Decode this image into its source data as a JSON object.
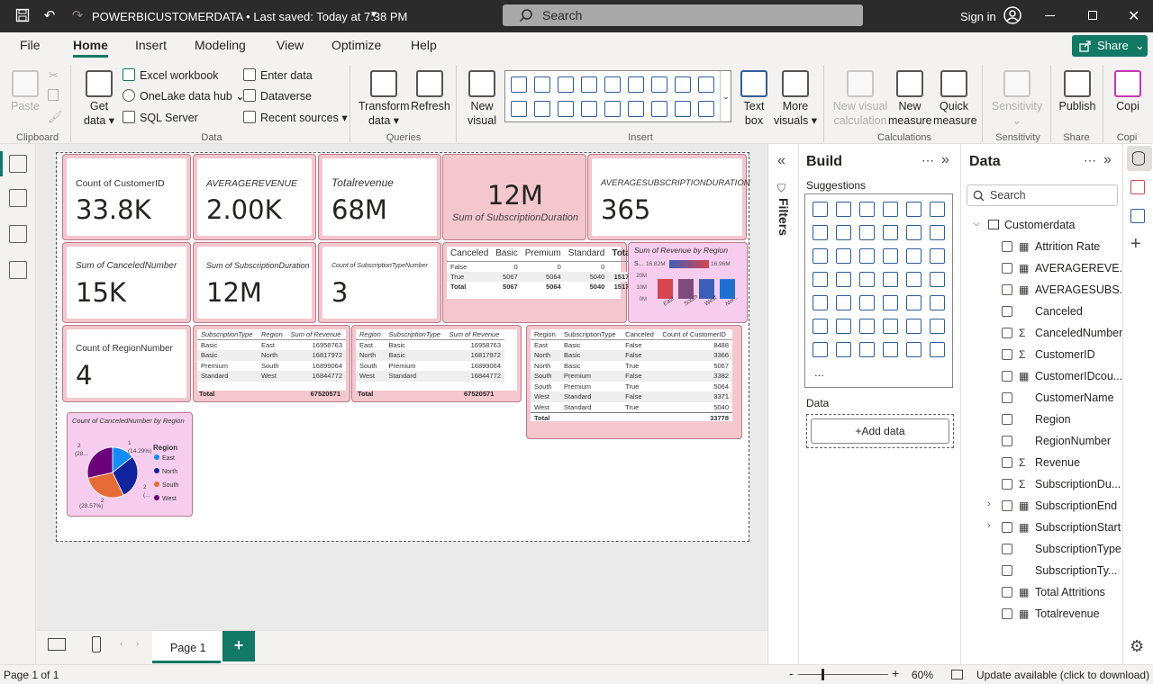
{
  "titlebar": {
    "title": "POWERBICUSTOMERDATA • Last saved: Today at 7:38 PM",
    "search": "Search",
    "signin": "Sign in"
  },
  "ribbon": {
    "tabs": [
      "File",
      "Home",
      "Insert",
      "Modeling",
      "View",
      "Optimize",
      "Help"
    ],
    "share": "Share",
    "paste": "Paste",
    "getdata": [
      "Get",
      "data ▾"
    ],
    "excel": "Excel workbook",
    "onelake": "OneLake data hub ⌄",
    "sql": "SQL Server",
    "enterdata": "Enter data",
    "dataverse": "Dataverse",
    "recent": "Recent sources ▾",
    "transform": [
      "Transform",
      "data ▾"
    ],
    "refresh": "Refresh",
    "newvisual": [
      "New",
      "visual"
    ],
    "textbox": [
      "Text",
      "box"
    ],
    "morevisuals": [
      "More",
      "visuals ▾"
    ],
    "newvisualcalc": [
      "New visual",
      "calculation"
    ],
    "newmeasure": [
      "New",
      "measure"
    ],
    "quickmeasure": [
      "Quick",
      "measure"
    ],
    "sensitivity": [
      "Sensitivity",
      "⌄"
    ],
    "publish": "Publish",
    "copilot": "Copi",
    "groups": [
      "Clipboard",
      "Data",
      "Queries",
      "Insert",
      "Calculations",
      "Sensitivity",
      "Share",
      "Copi"
    ]
  },
  "report": {
    "cards": [
      {
        "label": "Count of CustomerID",
        "value": "33.8K",
        "italic": false
      },
      {
        "label": "AVERAGEREVENUE",
        "value": "2.00K",
        "italic": true
      },
      {
        "label": "Totalrevenue",
        "value": "68M",
        "italic": true
      },
      {
        "label": "Sum of SubscriptionDuration",
        "value": "12M",
        "italic": true
      },
      {
        "label": "AVERAGESUBSCRIPTIONDURATION",
        "value": "365",
        "italic": true
      },
      {
        "label": "Sum of CanceledNumber",
        "value": "15K",
        "italic": true
      },
      {
        "label": "Sum of SubscriptionDuration",
        "value": "12M",
        "italic": true
      },
      {
        "label": "Count of SubscriptionTypeNumber",
        "value": "3",
        "italic": true
      },
      {
        "label": "Count of RegionNumber",
        "value": "4",
        "italic": false
      }
    ],
    "matrix": {
      "headers": [
        "Canceled",
        "Basic",
        "Premium",
        "Standard",
        "Total"
      ],
      "rows": [
        [
          "False",
          "0",
          "0",
          "0",
          "0"
        ],
        [
          "True",
          "5067",
          "5064",
          "5040",
          "15171"
        ],
        [
          "Total",
          "5067",
          "5064",
          "5040",
          "15171"
        ]
      ]
    },
    "revenue_by_region": {
      "title": "Sum of Revenue by Region",
      "legend_prefix": "S...",
      "legend_min": "16.82M",
      "legend_max": "16.96M",
      "yticks": [
        "20M",
        "10M",
        "0M"
      ]
    },
    "table1": {
      "headers": [
        "SubscriptionType",
        "Region",
        "Sum of Revenue"
      ],
      "rows": [
        [
          "Basic",
          "East",
          "16958763"
        ],
        [
          "Basic",
          "North",
          "16817972"
        ],
        [
          "Premium",
          "South",
          "16899064"
        ],
        [
          "Standard",
          "West",
          "16844772"
        ]
      ],
      "total": [
        "Total",
        "",
        "67520571"
      ]
    },
    "table2": {
      "headers": [
        "Region",
        "SubscriptionType",
        "Sum of Revenue"
      ],
      "rows": [
        [
          "East",
          "Basic",
          "16958763"
        ],
        [
          "North",
          "Basic",
          "16817972"
        ],
        [
          "South",
          "Premium",
          "16899064"
        ],
        [
          "West",
          "Standard",
          "16844772"
        ]
      ],
      "total": [
        "Total",
        "",
        "67520571"
      ]
    },
    "table3": {
      "headers": [
        "Region",
        "SubscriptionType",
        "Canceled",
        "Count of CustomerID"
      ],
      "rows": [
        [
          "East",
          "Basic",
          "False",
          "8488"
        ],
        [
          "North",
          "Basic",
          "False",
          "3366"
        ],
        [
          "North",
          "Basic",
          "True",
          "5067"
        ],
        [
          "South",
          "Premium",
          "False",
          "3382"
        ],
        [
          "South",
          "Premium",
          "True",
          "5064"
        ],
        [
          "West",
          "Standard",
          "False",
          "3371"
        ],
        [
          "West",
          "Standard",
          "True",
          "5040"
        ]
      ],
      "total": [
        "Total",
        "",
        "",
        "33778"
      ]
    },
    "pie": {
      "title": "Count of CanceledNumber by Region",
      "legend_title": "Region",
      "labels": {
        "top": "1",
        "top_pct": "(14.29%)",
        "left": "2",
        "left_pct": "(28...",
        "right": "2",
        "right_pct": "(...",
        "bottom": "2",
        "bottom_pct": "(28.57%)"
      }
    }
  },
  "chart_data": [
    {
      "type": "bar",
      "title": "Sum of Revenue by Region",
      "categories": [
        "East",
        "South",
        "West",
        "Nor..."
      ],
      "values": [
        16958763,
        16899064,
        16844772,
        16817972
      ],
      "ylabel": "",
      "ylim": [
        0,
        20000000
      ],
      "yticks": [
        "0M",
        "10M",
        "20M"
      ],
      "colors": [
        "#d64550",
        "#7f4a7e",
        "#3b5fb8",
        "#1f6fd1"
      ],
      "legend": "top, gradient 16.82M to 16.96M"
    },
    {
      "type": "pie",
      "title": "Count of CanceledNumber by Region",
      "categories": [
        "East",
        "North",
        "South",
        "West"
      ],
      "values": [
        1,
        2,
        2,
        2
      ],
      "colors": [
        "#118dff",
        "#12239e",
        "#e66c37",
        "#6b007b"
      ],
      "legend": "right"
    }
  ],
  "build": {
    "title": "Build",
    "suggestions": "Suggestions",
    "data_label": "Data",
    "add_data": "+Add data",
    "more": "..."
  },
  "filters_label": "Filters",
  "datapane": {
    "title": "Data",
    "search": "Search",
    "table": "Customerdata",
    "fields": [
      {
        "name": "Attrition Rate",
        "type": "calc"
      },
      {
        "name": "AVERAGEREVE...",
        "type": "calc"
      },
      {
        "name": "AVERAGESUBS...",
        "type": "calc"
      },
      {
        "name": "Canceled",
        "type": ""
      },
      {
        "name": "CanceledNumber",
        "type": "sum"
      },
      {
        "name": "CustomerID",
        "type": "sum"
      },
      {
        "name": "CustomerIDcou...",
        "type": "calc"
      },
      {
        "name": "CustomerName",
        "type": ""
      },
      {
        "name": "Region",
        "type": ""
      },
      {
        "name": "RegionNumber",
        "type": ""
      },
      {
        "name": "Revenue",
        "type": "sum"
      },
      {
        "name": "SubscriptionDu...",
        "type": "sum"
      },
      {
        "name": "SubscriptionEnd",
        "type": "date"
      },
      {
        "name": "SubscriptionStart",
        "type": "date"
      },
      {
        "name": "SubscriptionType",
        "type": ""
      },
      {
        "name": "SubscriptionTy...",
        "type": ""
      },
      {
        "name": "Total Attritions",
        "type": "calc"
      },
      {
        "name": "Totalrevenue",
        "type": "calc"
      }
    ]
  },
  "pages": {
    "tab": "Page 1",
    "add": "+"
  },
  "status": {
    "page": "Page 1 of 1",
    "zoom": "60%",
    "update": "Update available (click to download)",
    "zoom_level": 0.6
  }
}
